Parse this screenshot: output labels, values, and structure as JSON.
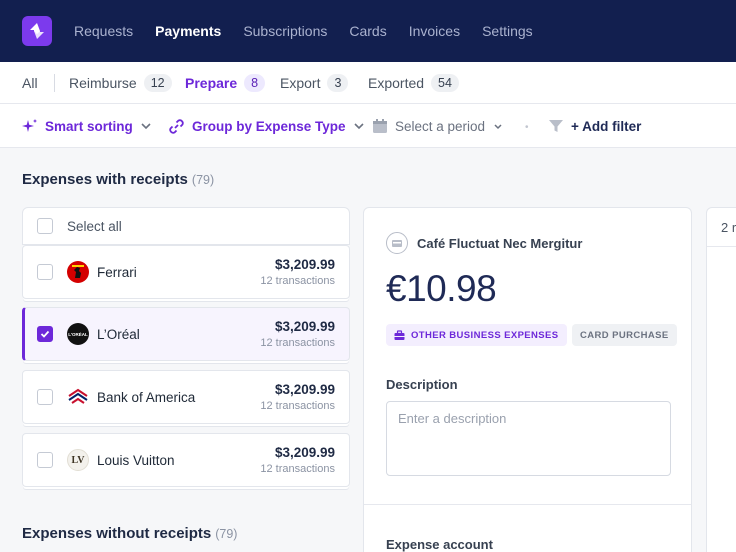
{
  "nav": {
    "items": [
      "Requests",
      "Payments",
      "Subscriptions",
      "Cards",
      "Invoices",
      "Settings"
    ],
    "active": "Payments"
  },
  "tabs": [
    {
      "label": "All",
      "count": ""
    },
    {
      "label": "Reimburse",
      "count": "12"
    },
    {
      "label": "Prepare",
      "count": "8"
    },
    {
      "label": "Export",
      "count": "3"
    },
    {
      "label": "Exported",
      "count": "54"
    }
  ],
  "toolbar": {
    "smart_sorting": "Smart sorting",
    "group_by": "Group by Expense Type",
    "period_placeholder": "Select a period",
    "add_filter": "+ Add filter"
  },
  "with_receipts": {
    "title": "Expenses with receipts",
    "count": "(79)",
    "select_all": "Select all",
    "rows": [
      {
        "name": "Ferrari",
        "amount": "$3,209.99",
        "transactions": "12 transactions",
        "checked": false,
        "logo_text": "F",
        "logo_color": "#d40000"
      },
      {
        "name": "L’Oréal",
        "amount": "$3,209.99",
        "transactions": "12 transactions",
        "checked": true,
        "logo_text": "L'ORÉAL",
        "logo_color": "#111111"
      },
      {
        "name": "Bank of America",
        "amount": "$3,209.99",
        "transactions": "12 transactions",
        "checked": false,
        "logo_text": "BofA",
        "logo_color": "#c8102e"
      },
      {
        "name": "Louis Vuitton",
        "amount": "$3,209.99",
        "transactions": "12 transactions",
        "checked": false,
        "logo_text": "LV",
        "logo_color": "#5b4a32"
      }
    ]
  },
  "without_receipts": {
    "title": "Expenses without receipts",
    "count": "(79)"
  },
  "detail": {
    "merchant": "Café Fluctuat Nec Mergitur",
    "amount": "€10.98",
    "category_tag": "OTHER BUSINESS EXPENSES",
    "type_tag": "CARD PURCHASE",
    "description_label": "Description",
    "description_placeholder": "Enter a description",
    "expense_account_label": "Expense account"
  },
  "peek_panel": {
    "text": "2 r"
  },
  "colors": {
    "nav_bg": "#121f4f",
    "accent": "#6d28d9"
  }
}
